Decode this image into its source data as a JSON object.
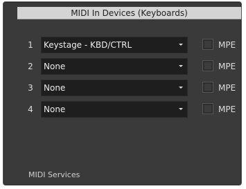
{
  "panel": {
    "title": "MIDI In Devices  (Keyboards)",
    "footer_label": "MIDI Services"
  },
  "devices": [
    {
      "number": "1",
      "selected": "Keystage - KBD/CTRL",
      "mpe_label": "MPE",
      "mpe_checked": false
    },
    {
      "number": "2",
      "selected": "None",
      "mpe_label": "MPE",
      "mpe_checked": false
    },
    {
      "number": "3",
      "selected": "None",
      "mpe_label": "MPE",
      "mpe_checked": false
    },
    {
      "number": "4",
      "selected": "None",
      "mpe_label": "MPE",
      "mpe_checked": false
    }
  ],
  "colors": {
    "panel_bg": "#3a3a3a",
    "title_bg": "#d4d4d4",
    "select_bg": "#1e1e1e",
    "text": "#dcdcdc"
  },
  "icons": {
    "dropdown": "chevron-down-icon"
  }
}
